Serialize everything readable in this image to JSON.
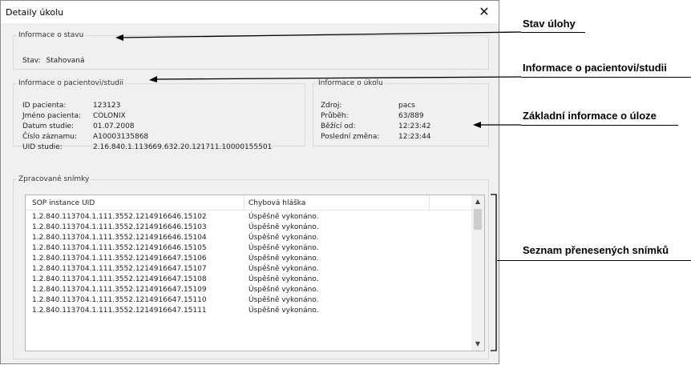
{
  "dialog": {
    "title": "Detaily úkolu",
    "close_symbol": "✕"
  },
  "status": {
    "legend": "Informace o stavu",
    "label": "Stav:",
    "value": "Stahovaná"
  },
  "patient": {
    "legend": "Informace o pacientovi/studii",
    "fields": [
      {
        "label": "ID pacienta:",
        "value": "123123"
      },
      {
        "label": "Jméno pacienta:",
        "value": "COLONIX"
      },
      {
        "label": "Datum studie:",
        "value": "01.07.2008"
      },
      {
        "label": "Číslo záznamu:",
        "value": "A10003135868"
      },
      {
        "label": "UID studie:",
        "value": "2.16.840.1.113669.632.20.121711.10000155501"
      }
    ]
  },
  "task": {
    "legend": "Informace o úkolu",
    "fields": [
      {
        "label": "Zdroj:",
        "value": "pacs"
      },
      {
        "label": "Průběh:",
        "value": "63/889"
      },
      {
        "label": "Běžící od:",
        "value": "12:23:42"
      },
      {
        "label": "Poslední změna:",
        "value": "12:23:44"
      }
    ]
  },
  "images": {
    "legend": "Zpracované snímky",
    "columns": [
      "SOP instance UID",
      "Chybová hláška"
    ],
    "rows": [
      [
        "1.2.840.113704.1.111.3552.1214916646.15102",
        "Úspěšně vykonáno."
      ],
      [
        "1.2.840.113704.1.111.3552.1214916646.15103",
        "Úspěšně vykonáno."
      ],
      [
        "1.2.840.113704.1.111.3552.1214916646.15104",
        "Úspěšně vykonáno."
      ],
      [
        "1.2.840.113704.1.111.3552.1214916646.15105",
        "Úspěšně vykonáno."
      ],
      [
        "1.2.840.113704.1.111.3552.1214916647.15106",
        "Úspěšně vykonáno."
      ],
      [
        "1.2.840.113704.1.111.3552.1214916647.15107",
        "Úspěšně vykonáno."
      ],
      [
        "1.2.840.113704.1.111.3552.1214916647.15108",
        "Úspěšně vykonáno."
      ],
      [
        "1.2.840.113704.1.111.3552.1214916647.15109",
        "Úspěšně vykonáno."
      ],
      [
        "1.2.840.113704.1.111.3552.1214916647.15110",
        "Úspěšně vykonáno."
      ],
      [
        "1.2.840.113704.1.111.3552.1214916647.15111",
        "Úspěšně vykonáno."
      ]
    ],
    "scroll_up_icon": "scroll-up-icon",
    "scroll_down_icon": "scroll-down-icon"
  },
  "annotations": {
    "status": "Stav úlohy",
    "patient": "Informace o pacientovi/studii",
    "task": "Základní informace o úloze",
    "images": "Seznam přenesených snímků"
  }
}
